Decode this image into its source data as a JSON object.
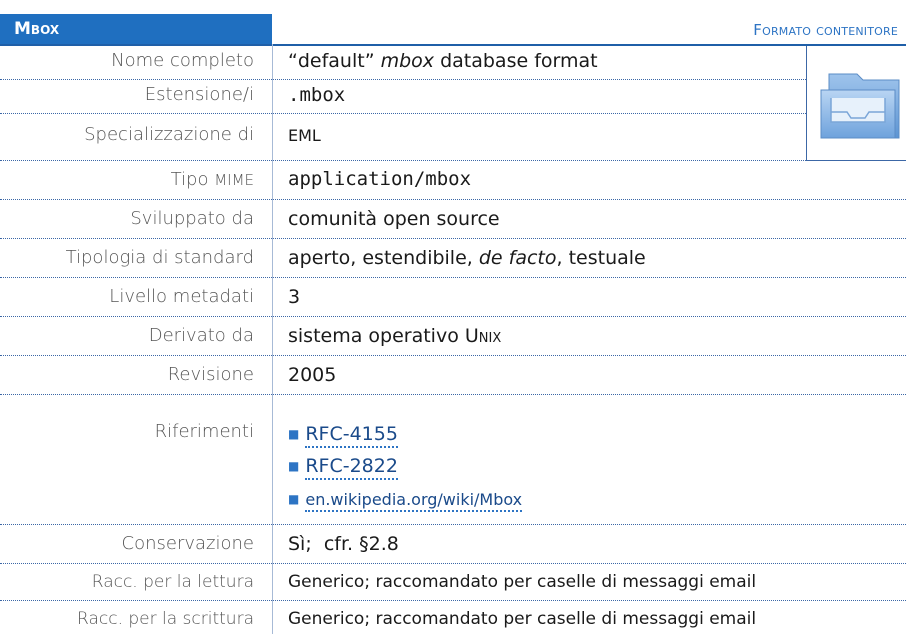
{
  "header": {
    "title": "Mbox",
    "category": "Formato contenitore"
  },
  "rows": {
    "nome": {
      "label": "Nome completo",
      "value_pre": "“default” ",
      "value_em": "mbox",
      "value_post": " database format"
    },
    "ext": {
      "label": "Estensione/i",
      "value": ".mbox"
    },
    "spec": {
      "label": "Specializzazione di",
      "value": "EML"
    },
    "mime": {
      "label_main": "Tipo ",
      "label_sc": "MIME",
      "value": "application/mbox"
    },
    "svil": {
      "label": "Sviluppato da",
      "value": "comunità open source"
    },
    "tipo": {
      "label": "Tipologia di standard",
      "value_pre": "aperto, estendibile, ",
      "value_em": "de facto",
      "value_post": ", testuale"
    },
    "livello": {
      "label": "Livello metadati",
      "value": "3"
    },
    "derivato": {
      "label": "Derivato da",
      "value_pre": "sistema operativo ",
      "value_sc": "Unix"
    },
    "revisione": {
      "label": "Revisione",
      "value": "2005"
    },
    "riferimenti": {
      "label": "Riferimenti",
      "items": [
        "RFC-4155",
        "RFC-2822",
        "en.wikipedia.org/wiki/Mbox"
      ]
    },
    "conservazione": {
      "label": "Conservazione",
      "value": "Sì;  cfr. §2.8"
    },
    "lettura": {
      "label": "Racc. per la lettura",
      "value": "Generico; raccomandato per caselle di messaggi email"
    },
    "scrittura": {
      "label": "Racc. per la scrittura",
      "value": "Generico; raccomandato per caselle di messaggi email"
    }
  },
  "icon": {
    "name": "mailbox-folder-icon"
  },
  "colors": {
    "accent": "#1f6fc0",
    "separator": "#3c67a6"
  }
}
